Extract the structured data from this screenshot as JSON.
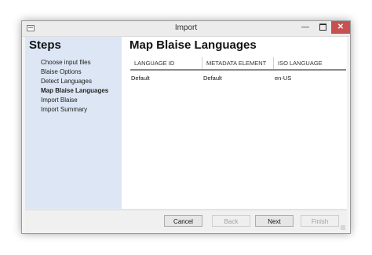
{
  "window": {
    "title": "Import",
    "minimize_glyph": "—",
    "close_glyph": "✕"
  },
  "sidebar": {
    "title": "Steps",
    "items": [
      {
        "label": "Choose input files",
        "active": false
      },
      {
        "label": "Blaise Options",
        "active": false
      },
      {
        "label": "Detect Languages",
        "active": false
      },
      {
        "label": "Map Blaise Languages",
        "active": true
      },
      {
        "label": "Import Blaise",
        "active": false
      },
      {
        "label": "Import Summary",
        "active": false
      }
    ]
  },
  "main": {
    "title": "Map Blaise Languages",
    "columns": [
      "LANGUAGE ID",
      "METADATA ELEMENT",
      "ISO LANGUAGE"
    ],
    "rows": [
      [
        "Default",
        "Default",
        "en-US"
      ]
    ]
  },
  "footer": {
    "cancel_label": "Cancel",
    "back_label": "Back",
    "next_label": "Next",
    "finish_label": "Finish"
  },
  "colors": {
    "sidebar_bg": "#dce6f4",
    "close_button": "#c75050"
  }
}
